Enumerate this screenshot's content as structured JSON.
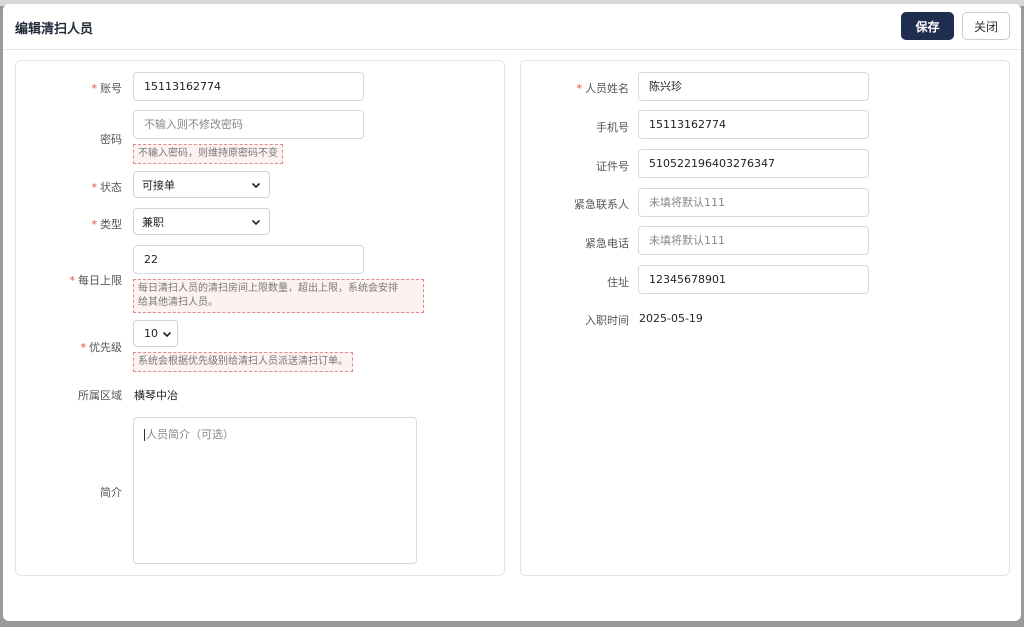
{
  "modal": {
    "title": "编辑清扫人员",
    "save_label": "保存",
    "close_label": "关闭"
  },
  "left": {
    "account": {
      "label": "账号",
      "value": "15113162774"
    },
    "password": {
      "label": "密码",
      "placeholder": "不输入则不修改密码",
      "hint": "不输入密码，则维持原密码不变"
    },
    "status": {
      "label": "状态",
      "value": "可接单"
    },
    "type": {
      "label": "类型",
      "value": "兼职"
    },
    "daily_limit": {
      "label": "每日上限",
      "value": "22",
      "hint_line1": "每日清扫人员的清扫房间上限数量，超出上限，系统会安排",
      "hint_line2": "给其他清扫人员。"
    },
    "priority": {
      "label": "优先级",
      "value": "10",
      "hint": "系统会根据优先级别给清扫人员派送清扫订单。"
    },
    "region": {
      "label": "所属区域",
      "value": "横琴中冶"
    },
    "intro": {
      "label": "简介",
      "placeholder": "人员简介（可选）"
    }
  },
  "right": {
    "name": {
      "label": "人员姓名",
      "value": "陈兴珍"
    },
    "phone": {
      "label": "手机号",
      "value": "15113162774"
    },
    "id_no": {
      "label": "证件号",
      "value": "510522196403276347"
    },
    "emergency_contact": {
      "label": "紧急联系人",
      "placeholder": "未填将默认111"
    },
    "emergency_phone": {
      "label": "紧急电话",
      "placeholder": "未填将默认111"
    },
    "address": {
      "label": "住址",
      "value": "12345678901"
    },
    "hire_date": {
      "label": "入职时间",
      "value": "2025-05-19"
    }
  },
  "colors": {
    "primary": "#1f2d4f",
    "required": "#e04a4a",
    "hint_border": "#e08a8a"
  }
}
